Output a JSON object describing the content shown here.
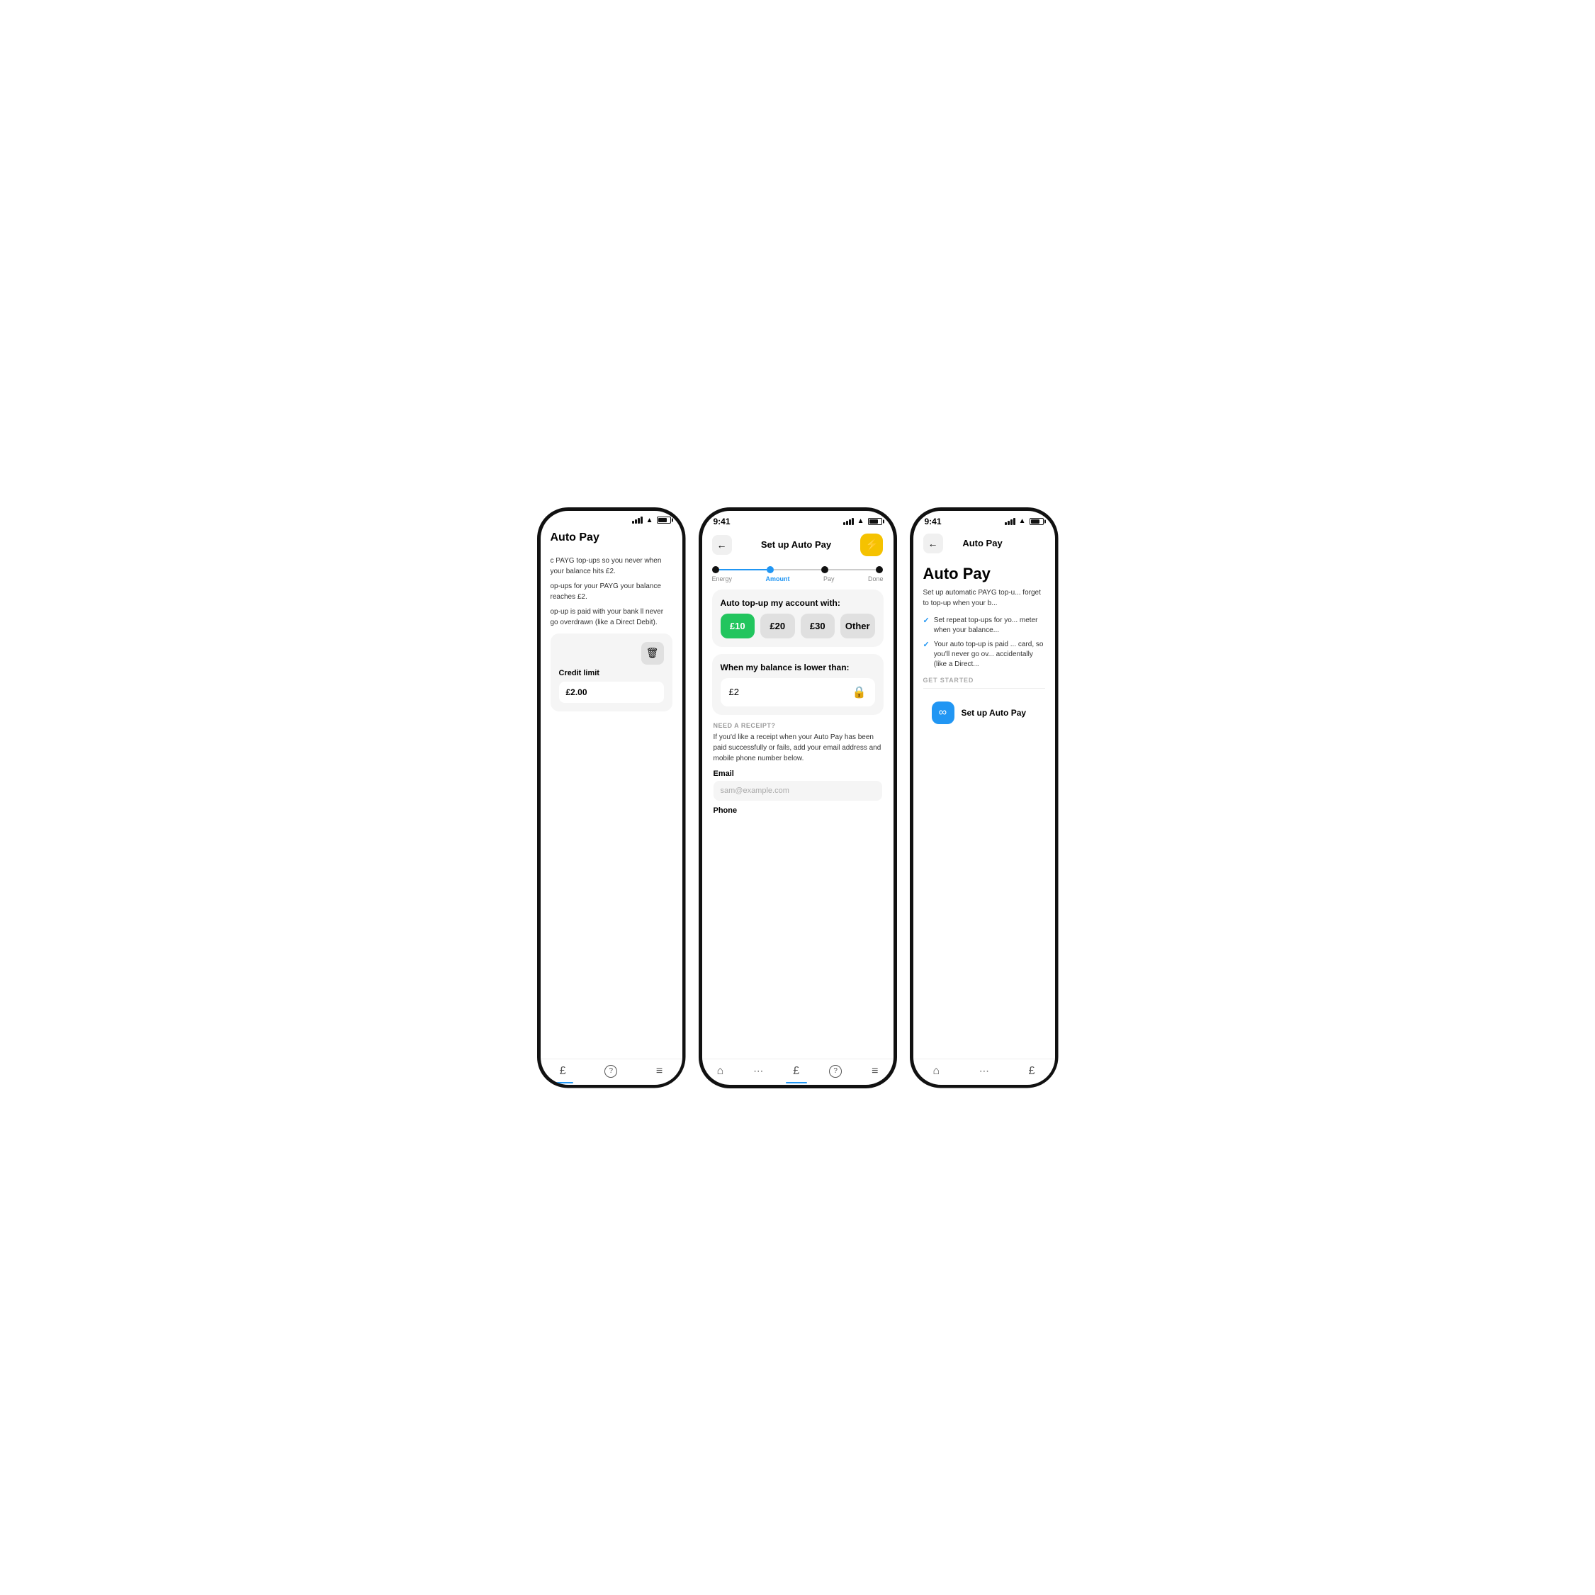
{
  "left_phone": {
    "page_title": "Auto Pay",
    "desc1": "c PAYG top-ups so you never when your balance hits £2.",
    "desc2": "op-ups for your PAYG your balance reaches £2.",
    "desc3": "op-up is paid with your bank ll never go overdrawn (like a Direct Debit).",
    "credit_limit_label": "Credit limit",
    "credit_limit_value": "£2.00",
    "nav_items": [
      "£",
      "?",
      "≡"
    ]
  },
  "center_phone": {
    "status_time": "9:41",
    "header_title": "Set up Auto Pay",
    "stepper": {
      "steps": [
        "Energy",
        "Amount",
        "Pay",
        "Done"
      ],
      "active_index": 1
    },
    "card1": {
      "title": "Auto top-up my account with:",
      "options": [
        "£10",
        "£20",
        "£30",
        "Other"
      ],
      "selected_index": 0
    },
    "card2": {
      "title": "When my balance is lower than:",
      "value": "£2"
    },
    "receipt_section": {
      "label": "NEED A RECEIPT?",
      "text": "If you'd like a receipt when your Auto Pay has been paid successfully or fails, add your email address and mobile phone number below.",
      "email_label": "Email",
      "email_placeholder": "sam@example.com",
      "phone_label": "Phone"
    },
    "nav_items": [
      "🏠",
      "⋯",
      "£",
      "?",
      "≡"
    ]
  },
  "right_phone": {
    "status_time": "9:41",
    "header_title": "Auto Pay",
    "page_title": "Auto Pay",
    "desc": "Set up automatic PAYG top-u... forget to top-up when your b...",
    "check_items": [
      "Set repeat top-ups for yo... meter when your balance...",
      "Your auto top-up is paid ... card, so you'll never go ov... accidentally (like a Direct..."
    ],
    "get_started_label": "GET STARTED",
    "setup_btn_label": "Set up Auto Pay",
    "nav_items": [
      "🏠",
      "⋯",
      "£"
    ]
  },
  "icons": {
    "back_arrow": "←",
    "lightning": "⚡",
    "lock": "🔒",
    "trash": "🗑",
    "infinity": "∞",
    "check": "✓"
  },
  "colors": {
    "green": "#22c55e",
    "blue": "#2196F3",
    "yellow": "#f5c200",
    "light_gray": "#f5f5f5",
    "dark": "#111"
  }
}
